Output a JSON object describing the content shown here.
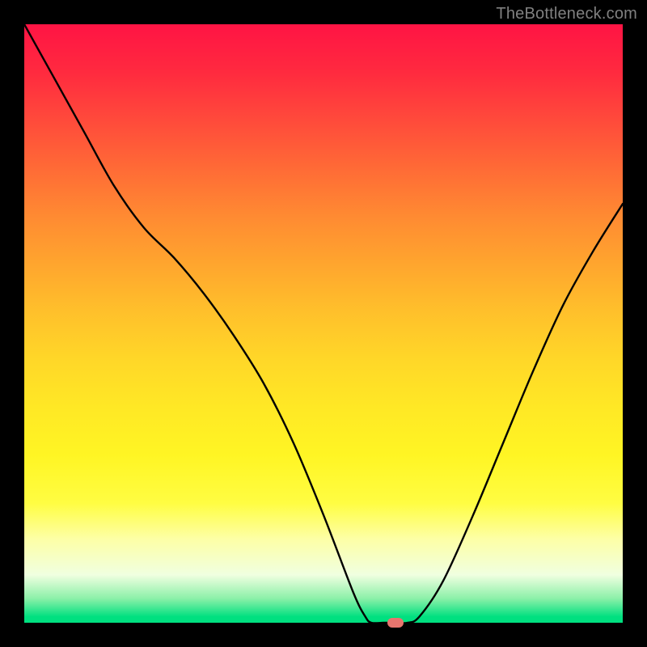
{
  "watermark": "TheBottleneck.com",
  "chart_data": {
    "type": "line",
    "title": "",
    "xlabel": "",
    "ylabel": "",
    "xlim": [
      0,
      100
    ],
    "ylim": [
      0,
      100
    ],
    "grid": false,
    "series": [
      {
        "name": "curve",
        "x": [
          0,
          5,
          10,
          15,
          20,
          25,
          30,
          35,
          40,
          45,
          50,
          55,
          57,
          58,
          60,
          62,
          64,
          66,
          70,
          75,
          80,
          85,
          90,
          95,
          100
        ],
        "values": [
          100,
          91,
          82,
          73,
          66,
          61,
          55,
          48,
          40,
          30,
          18,
          5,
          1,
          0,
          0,
          0,
          0,
          1,
          7,
          18,
          30,
          42,
          53,
          62,
          70
        ]
      }
    ],
    "marker": {
      "x": 62,
      "y": 0,
      "color": "#e8756e"
    },
    "gradient_stops": [
      {
        "offset": 0,
        "color": "#ff1444"
      },
      {
        "offset": 50,
        "color": "#ffd728"
      },
      {
        "offset": 90,
        "color": "#f0ffe0"
      },
      {
        "offset": 100,
        "color": "#00e080"
      }
    ]
  }
}
